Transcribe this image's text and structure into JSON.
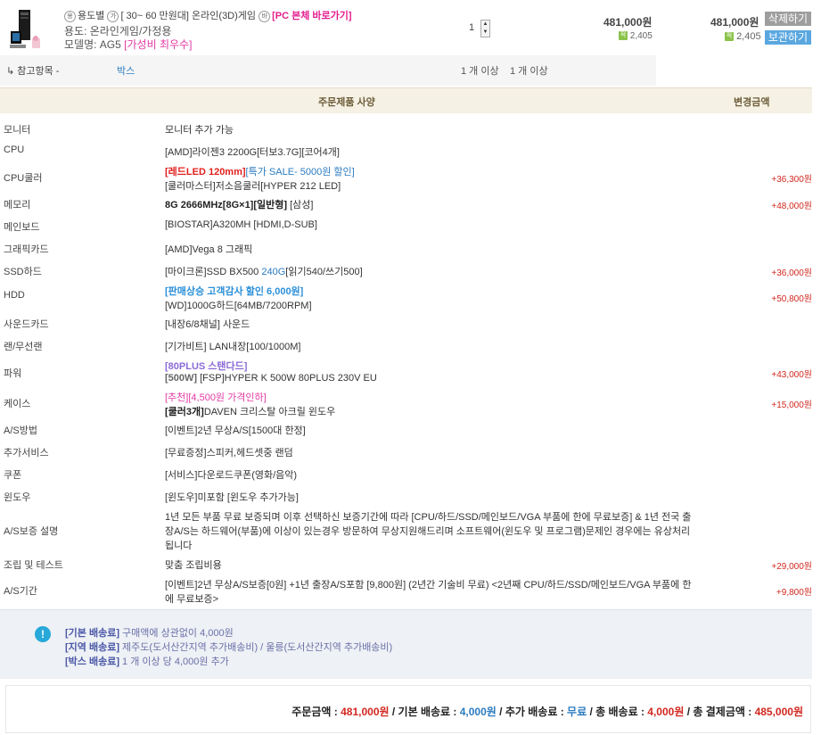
{
  "product": {
    "tag_use_icon": "용",
    "tag_use": "용도별",
    "tag_price_icon": "가",
    "tag_price": "[ 30~ 60 만원대]",
    "tag_spec": "온라인(3D)게임",
    "tag_link_icon": "바",
    "pc_link": "[PC 본체 바로가기]",
    "usage_line": "용도: 온라인게임/가정용",
    "model_prefix": "모델명: AG5",
    "model_highlight": "[가성비 최우수]",
    "quantity": "1",
    "price": "481,000원",
    "points": "2,405",
    "price_total": "481,000원",
    "points_total": "2,405",
    "point_icon": "적",
    "delete_label": "삭제하기",
    "keep_label": "보관하기"
  },
  "reference": {
    "label": "↳ 참고항목 -",
    "value": "박스",
    "qty1": "1 개 이상",
    "qty2": "1 개 이상"
  },
  "spec_header": {
    "spec_col": "주문제품 사양",
    "amount_col": "변경금액"
  },
  "specs": [
    {
      "label": "모니터",
      "parts": [
        {
          "t": "모니터 추가 가능"
        }
      ],
      "amount": ""
    },
    {
      "label": "CPU",
      "parts": [
        {
          "t": "[AMD]라이젠3 2200G[터보3.7G][코어4개]"
        }
      ],
      "amount": ""
    },
    {
      "label": "CPU쿨러",
      "parts": [
        {
          "t": "[레드LED 120mm]",
          "c": "red-b"
        },
        {
          "t": "[특가 SALE- 5000원 할인]",
          "c": "blue"
        }
      ],
      "parts2": [
        {
          "t": "[쿨러마스터]저소음쿨러[HYPER 212 LED]"
        }
      ],
      "amount": "+36,300원"
    },
    {
      "label": "메모리",
      "parts": [
        {
          "t": "8G 2666MHz[8G×1][일반형]",
          "c": "dark-b"
        },
        {
          "t": " [삼성]"
        }
      ],
      "amount": "+48,000원"
    },
    {
      "label": "메인보드",
      "parts": [
        {
          "t": "[BIOSTAR]A320MH [HDMI,D-SUB]"
        }
      ],
      "amount": ""
    },
    {
      "label": "그래픽카드",
      "parts": [
        {
          "t": "[AMD]Vega 8 그래픽"
        }
      ],
      "amount": ""
    },
    {
      "label": "SSD하드",
      "parts": [
        {
          "t": "[마이크론]SSD BX500 "
        },
        {
          "t": "240G",
          "c": "blue"
        },
        {
          "t": "[읽기540/쓰기500]"
        }
      ],
      "amount": "+36,000원"
    },
    {
      "label": "HDD",
      "parts": [
        {
          "t": "[판매상승 고객감사 할인 6,000원]",
          "c": "blue-b"
        }
      ],
      "parts2": [
        {
          "t": "[WD]1000G하드[64MB/7200RPM]"
        }
      ],
      "amount": "+50,800원"
    },
    {
      "label": "사운드카드",
      "parts": [
        {
          "t": "[내장6/8채널] 사운드"
        }
      ],
      "amount": ""
    },
    {
      "label": "랜/무선랜",
      "parts": [
        {
          "t": "[기가비트] LAN내장[100/1000M]"
        }
      ],
      "amount": ""
    },
    {
      "label": "파워",
      "parts": [
        {
          "t": "[80PLUS 스탠다드]",
          "c": "purple-b"
        }
      ],
      "parts2": [
        {
          "t": "[500W]",
          "c": "gray-b"
        },
        {
          "t": " [FSP]HYPER K 500W 80PLUS 230V EU"
        }
      ],
      "amount": "+43,000원"
    },
    {
      "label": "케이스",
      "parts": [
        {
          "t": "[추천][4,500원 가격인하]",
          "c": "magenta"
        }
      ],
      "parts2": [
        {
          "t": "[쿨러3개]",
          "c": "dark-b"
        },
        {
          "t": "DAVEN 크리스탈 아크릴 윈도우"
        }
      ],
      "amount": "+15,000원"
    },
    {
      "label": "A/S방법",
      "parts": [
        {
          "t": "[이벤트]2년 무상A/S[1500대 한정]"
        }
      ],
      "amount": ""
    },
    {
      "label": "추가서비스",
      "parts": [
        {
          "t": "[무료증정]스피커,헤드셋중 랜덤"
        }
      ],
      "amount": ""
    },
    {
      "label": "쿠폰",
      "parts": [
        {
          "t": "[서비스]다운로드쿠폰(영화/음악)"
        }
      ],
      "amount": ""
    },
    {
      "label": "윈도우",
      "parts": [
        {
          "t": "[윈도우]미포함 [윈도우 추가가능]"
        }
      ],
      "amount": ""
    },
    {
      "label": "A/S보증 설명",
      "parts": [
        {
          "t": "1년 모든 부품 무료 보증되며 이후 선택하신 보증기간에 따라 [CPU/하드/SSD/메인보드/VGA 부품에 한에 무료보증] & 1년 전국 출"
        }
      ],
      "parts2": [
        {
          "t": "장A/S는 하드웨어(부품)에 이상이 있는경우 방문하여 무상지원해드리며 소프트웨어(윈도우 및 프로그램)문제인 경우에는 유상처리"
        }
      ],
      "parts3": [
        {
          "t": "됩니다"
        }
      ],
      "amount": ""
    },
    {
      "label": "조립 및 테스트",
      "parts": [
        {
          "t": "맞춤 조립비용"
        }
      ],
      "amount": "+29,000원"
    },
    {
      "label": "A/S기간",
      "parts": [
        {
          "t": "[이벤트]2년 무상A/S보증[0원] +1년 출장A/S포함 [9,800원] (2년간 기술비 무료) <2년째 CPU/하드/SSD/메인보드/VGA 부품에 한"
        }
      ],
      "parts2": [
        {
          "t": "에 무료보증>"
        }
      ],
      "amount": "+9,800원"
    }
  ],
  "shipping": {
    "icon": "!",
    "line1_label": "[기본 배송료]",
    "line1_text": " 구매액에 상관없이 4,000원",
    "line2_label": "[지역 배송료]",
    "line2_text": " 제주도(도서산간지역 추가배송비) / 울릉(도서산간지역 추가배송비)",
    "line3_label": "[박스 배송료]",
    "line3_text": " 1 개 이상 당 4,000원 추가"
  },
  "totals": {
    "order_label": "주문금액 : ",
    "order_value": "481,000원",
    "base_label": " / 기본 배송료 : ",
    "base_value": "4,000원",
    "extra_label": " / 추가 배송료 : ",
    "extra_value": "무료",
    "ship_total_label": " / 총 배송료 : ",
    "ship_total_value": "4,000원",
    "grand_label": " / 총 결제금액 : ",
    "grand_value": "485,000원"
  }
}
